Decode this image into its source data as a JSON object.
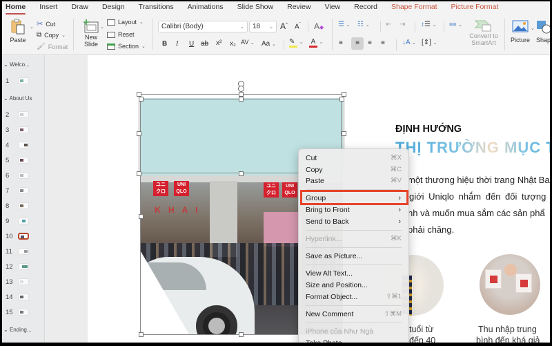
{
  "tabs": [
    {
      "label": "Home",
      "active": true
    },
    {
      "label": "Insert"
    },
    {
      "label": "Draw"
    },
    {
      "label": "Design"
    },
    {
      "label": "Transitions"
    },
    {
      "label": "Animations"
    },
    {
      "label": "Slide Show"
    },
    {
      "label": "Review"
    },
    {
      "label": "View"
    },
    {
      "label": "Record"
    },
    {
      "label": "Shape Format",
      "contextual": true
    },
    {
      "label": "Picture Format",
      "contextual": true
    }
  ],
  "ribbon": {
    "paste": "Paste",
    "cut": "Cut",
    "copy": "Copy",
    "format": "Format",
    "new_slide": "New\nSlide",
    "new_slide_l1": "New",
    "new_slide_l2": "Slide",
    "layout": "Layout",
    "reset": "Reset",
    "section": "Section",
    "font_name": "Calibri (Body)",
    "font_size": "18",
    "bold": "B",
    "italic": "I",
    "underline": "U",
    "strikethrough": "ab",
    "superscript": "x²",
    "subscript": "x₂",
    "char_spacing": "AV",
    "change_case": "Aa",
    "convert_smartart_l1": "Convert to",
    "convert_smartart_l2": "SmartArt",
    "picture": "Picture",
    "shapes": "Shap"
  },
  "sidebar": {
    "sections": [
      {
        "label": "Welco..."
      },
      {
        "label": "About Us"
      },
      {
        "label": "Ending..."
      }
    ],
    "slides": [
      "1",
      "2",
      "3",
      "4",
      "5",
      "6",
      "7",
      "8",
      "9",
      "10",
      "11",
      "12",
      "13",
      "14",
      "15"
    ],
    "selected_slide": "10"
  },
  "slide": {
    "heading1": "ĐỊNH HƯỚNG",
    "heading2": "THỊ TRƯỜNG MỤC T",
    "body_lines": [
      "một thương hiệu thời trang Nhật Ba",
      "giới  Uniqlo  nhắm  đến  đối  tượng",
      "nh và muốn mua sắm các sản phẩ",
      "phải chăng."
    ],
    "caption1_l1": "tuổi từ",
    "caption1_l2": "đến 40",
    "caption2_l1": "Thu nhập trung",
    "caption2_l2": "bình đến khá giả",
    "logo_text_1": "ユニ\nクロ",
    "logo_text_2": "UNI\nQLO",
    "store_text": "K H A I"
  },
  "context_menu": {
    "items": [
      {
        "label": "Cut",
        "shortcut": "⌘X"
      },
      {
        "label": "Copy",
        "shortcut": "⌘C"
      },
      {
        "label": "Paste",
        "shortcut": "⌘V"
      },
      {
        "label": "Group",
        "submenu": true,
        "highlighted": true
      },
      {
        "label": "Bring to Front",
        "submenu": true
      },
      {
        "label": "Send to Back",
        "submenu": true
      },
      {
        "label": "Hyperlink...",
        "shortcut": "⌘K",
        "disabled": true
      },
      {
        "label": "Save as Picture..."
      },
      {
        "label": "View Alt Text..."
      },
      {
        "label": "Size and Position..."
      },
      {
        "label": "Format Object...",
        "shortcut": "⇧⌘1"
      },
      {
        "label": "New Comment",
        "shortcut": "⇧⌘M"
      },
      {
        "label": "iPhone của Như Ngà",
        "disabled": true
      },
      {
        "label": "Take Photo"
      }
    ]
  },
  "colors": {
    "accent": "#c0504d",
    "contextual_tab": "#c8553d",
    "highlight_box": "#e7442a",
    "teal_shape": "#bfe1e1"
  }
}
